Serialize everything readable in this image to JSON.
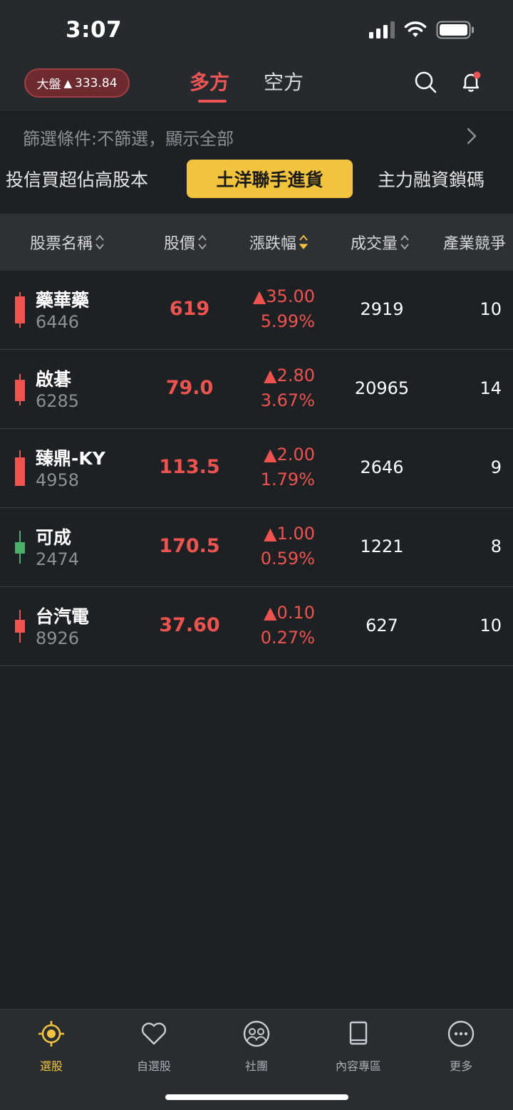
{
  "status_bar": {
    "time": "3:07"
  },
  "header": {
    "index_label": "大盤",
    "index_arrow": "▲",
    "index_value": "333.84",
    "tabs": [
      {
        "label": "多方",
        "active": true
      },
      {
        "label": "空方",
        "active": false
      }
    ],
    "icons": [
      "search-icon",
      "bell-icon"
    ]
  },
  "filter": {
    "text": "篩選條件:不篩選，顯示全部"
  },
  "segments": [
    {
      "label": "投信買超佔高股本",
      "active": false
    },
    {
      "label": "土洋聯手進貨",
      "active": true
    },
    {
      "label": "主力融資鎖碼",
      "active": false
    }
  ],
  "table": {
    "columns": [
      "股票名稱",
      "股價",
      "漲跌幅",
      "成交量",
      "產業競爭"
    ],
    "rows": [
      {
        "name": "藥華藥",
        "code": "6446",
        "price": "619",
        "change": "▲35.00",
        "change_pct": "5.99%",
        "volume": "2919",
        "industry": "10",
        "candle": "red"
      },
      {
        "name": "啟碁",
        "code": "6285",
        "price": "79.0",
        "change": "▲2.80",
        "change_pct": "3.67%",
        "volume": "20965",
        "industry": "14",
        "candle": "red"
      },
      {
        "name": "臻鼎-KY",
        "code": "4958",
        "price": "113.5",
        "change": "▲2.00",
        "change_pct": "1.79%",
        "volume": "2646",
        "industry": "9",
        "candle": "red"
      },
      {
        "name": "可成",
        "code": "2474",
        "price": "170.5",
        "change": "▲1.00",
        "change_pct": "0.59%",
        "volume": "1221",
        "industry": "8",
        "candle": "green"
      },
      {
        "name": "台汽電",
        "code": "8926",
        "price": "37.60",
        "change": "▲0.10",
        "change_pct": "0.27%",
        "volume": "627",
        "industry": "10",
        "candle": "red"
      }
    ]
  },
  "bottom_nav": [
    {
      "label": "選股",
      "icon": "target-icon",
      "active": true
    },
    {
      "label": "自選股",
      "icon": "heart-icon",
      "active": false
    },
    {
      "label": "社團",
      "icon": "community-icon",
      "active": false
    },
    {
      "label": "內容專區",
      "icon": "book-icon",
      "active": false
    },
    {
      "label": "更多",
      "icon": "more-icon",
      "active": false
    }
  ],
  "colors": {
    "up": "#ef5350",
    "down": "#4caf6a",
    "accent": "#f2c33c",
    "bg": "#1e2124"
  }
}
